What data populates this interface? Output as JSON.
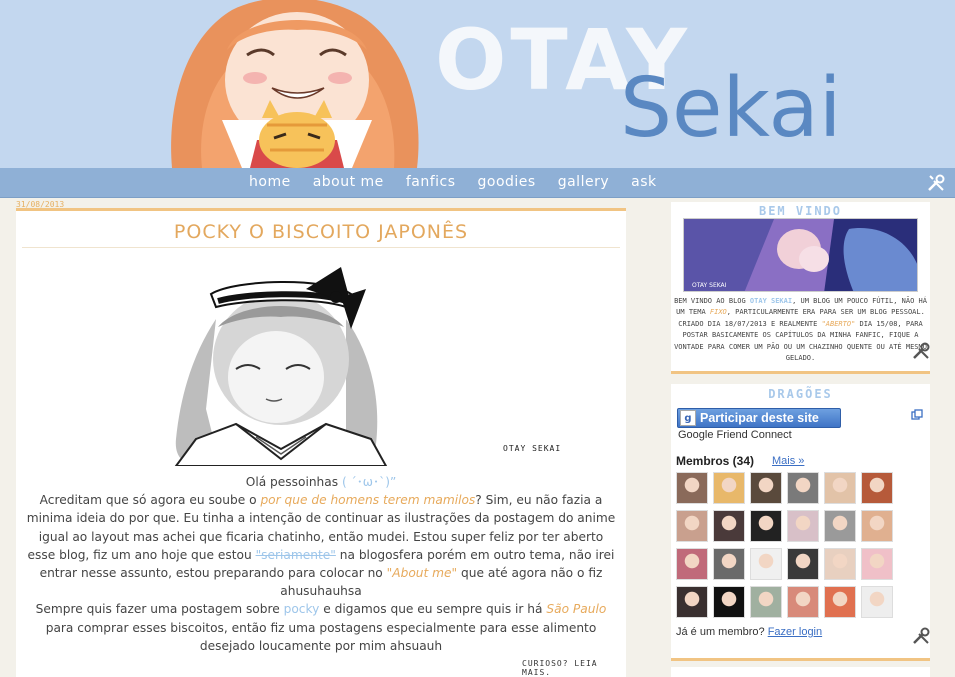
{
  "header": {
    "logo_top": "OTAY",
    "logo_bottom": "Sekai"
  },
  "nav": {
    "items": [
      {
        "label": "Home"
      },
      {
        "label": "About me"
      },
      {
        "label": "Fanfics"
      },
      {
        "label": "Goodies"
      },
      {
        "label": "Gallery"
      },
      {
        "label": "Ask"
      }
    ]
  },
  "post": {
    "date": "31/08/2013",
    "title": "POCKY O BISCOITO JAPONÊS",
    "image_watermark": "OTAY SEKAI",
    "greeting": "Olá pessoinhas ",
    "greeting_emote": "( ´･ω･`)”",
    "p1_a": "Acreditam que só agora eu soube o ",
    "p1_link": "por que de homens terem mamilos",
    "p1_b": "? Sim, eu não fazia a minima ideia do por que. Eu tinha a intenção de continuar as ilustrações da postagem do anime igual ao layout mas achei que ficaria chatinho, então mudei. Estou super feliz por ter aberto esse blog, fiz um ano hoje que estou ",
    "p1_strike": "\"seriamente\"",
    "p1_c": " na blogosfera porém em outro tema, não irei entrar nesse assunto, estou preparando para colocar no ",
    "p1_about": "\"About me\"",
    "p1_d": " que até agora não o fiz ahusuhauhsa",
    "p2_a": "Sempre quis fazer uma postagem sobre ",
    "p2_pocky": "pocky",
    "p2_b": " e digamos que eu sempre quis ir há ",
    "p2_sp": "São Paulo",
    "p2_c": " para comprar esses biscoitos, então fiz uma postagens especialmente para esse alimento desejado loucamente por mim ahsuauh",
    "read_more": "CURIOSO? LEIA MAIS."
  },
  "sidebar": {
    "welcome": {
      "title": "BEM VINDO",
      "image_caption": "OTAY SEKAI",
      "t1": "BEM VINDO AO BLOG ",
      "t_blog": "OTAY SEKAI",
      "t2": ", UM BLOG UM POUCO FÚTIL, NÃO HÁ UM TEMA ",
      "t_fixo": "FIXO",
      "t3": ", PARTICULARMENTE ERA PARA SER UM BLOG PESSOAL. CRIADO DIA 18/07/2013 E REALMENTE ",
      "t_aberto": "\"ABERTO\"",
      "t4": " DIA 15/08, PARA POSTAR BASICAMENTE OS CAPÍTULOS DA MINHA FANFIC, FIQUE A VONTADE PARA COMER UM PÃO OU UM CHAZINHO QUENTE OU ATÉ MESMO GELADO."
    },
    "followers": {
      "title": "DRAGÕES",
      "button_label": "Participar deste site",
      "subtitle": "Google Friend Connect",
      "members_label": "Membros (34)",
      "more_label": "Mais »",
      "question": "Já é um membro? ",
      "login_label": "Fazer login",
      "avatar_colors": [
        "#8a6a5a",
        "#e8b86a",
        "#5a4a3c",
        "#7a7a7a",
        "#e2c3a8",
        "#b65a3a",
        "#c9a08e",
        "#4a3a3a",
        "#222222",
        "#d8c0c8",
        "#9a9a9a",
        "#e0b090",
        "#c06a7a",
        "#6a6a6a",
        "#f0f0f0",
        "#3a3a3a",
        "#e8d0c0",
        "#f0c0c8",
        "#3a3030",
        "#111111",
        "#a0b0a0",
        "#d88a7a",
        "#e07050",
        "#eeeeee"
      ]
    }
  },
  "colors": {
    "header_bg": "#c3d7ef",
    "nav_bg": "#8fb0d6",
    "accent_orange": "#e3a85e",
    "accent_blue": "#9ec6ea",
    "logo_blue": "#5a88c2"
  }
}
